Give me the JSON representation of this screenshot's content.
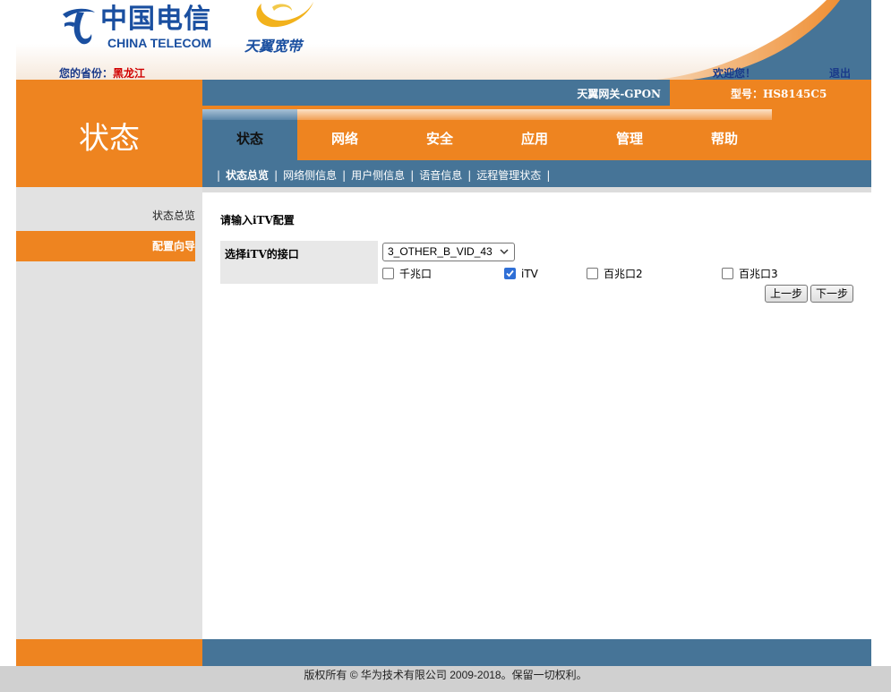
{
  "header": {
    "logo_cn": "中国电信",
    "logo_en": "CHINA TELECOM",
    "brand": "天翼宽带",
    "province_label": "您的省份：",
    "province_value": "黑龙江",
    "welcome": "欢迎您！",
    "logout": "退出"
  },
  "infobar": {
    "gateway": "天翼网关-GPON",
    "model": "型号：HS8145C5"
  },
  "left_title": "状态",
  "tabs": [
    {
      "label": "状态",
      "active": true
    },
    {
      "label": "网络",
      "active": false
    },
    {
      "label": "安全",
      "active": false
    },
    {
      "label": "应用",
      "active": false
    },
    {
      "label": "管理",
      "active": false
    },
    {
      "label": "帮助",
      "active": false
    }
  ],
  "subnav": [
    {
      "label": "状态总览",
      "active": true
    },
    {
      "label": "网络侧信息",
      "active": false
    },
    {
      "label": "用户侧信息",
      "active": false
    },
    {
      "label": "语音信息",
      "active": false
    },
    {
      "label": "远程管理状态",
      "active": false
    }
  ],
  "sidebar": {
    "items": [
      {
        "label": "状态总览",
        "active": false
      },
      {
        "label": "配置向导",
        "active": true
      }
    ]
  },
  "main": {
    "title": "请输入iTV配置",
    "iface_label": "选择iTV的接口",
    "iface_select": "3_OTHER_B_VID_43",
    "checkboxes": [
      {
        "label": "千兆口",
        "checked": false
      },
      {
        "label": "iTV",
        "checked": true
      },
      {
        "label": "百兆口2",
        "checked": false
      },
      {
        "label": "百兆口3",
        "checked": false
      }
    ],
    "prev_button": "上一步",
    "next_button": "下一步"
  },
  "footer": {
    "copyright": "版权所有 © 华为技术有限公司 2009-2018。保留一切权利。"
  },
  "colors": {
    "orange": "#ee8420",
    "steel_blue": "#467497",
    "logo_blue": "#1a4fa0"
  }
}
